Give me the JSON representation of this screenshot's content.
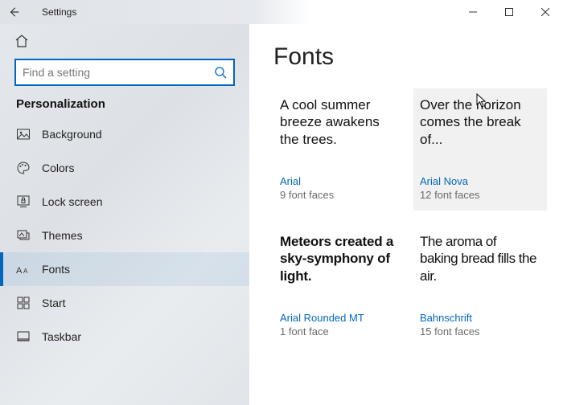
{
  "titlebar": {
    "title": "Settings"
  },
  "search": {
    "placeholder": "Find a setting"
  },
  "sidebar": {
    "section": "Personalization",
    "items": [
      {
        "label": "Background"
      },
      {
        "label": "Colors"
      },
      {
        "label": "Lock screen"
      },
      {
        "label": "Themes"
      },
      {
        "label": "Fonts"
      },
      {
        "label": "Start"
      },
      {
        "label": "Taskbar"
      }
    ],
    "selected_index": 4
  },
  "page": {
    "title": "Fonts"
  },
  "fonts": [
    {
      "sample": "A cool summer breeze awakens the trees.",
      "name": "Arial",
      "faces": "9 font faces",
      "style": "normal"
    },
    {
      "sample": "Over the horizon comes the break of...",
      "name": "Arial Nova",
      "faces": "12 font faces",
      "style": "normal",
      "hover": true
    },
    {
      "sample": "Meteors created a sky-symphony of light.",
      "name": "Arial Rounded MT",
      "faces": "1 font face",
      "style": "rounded"
    },
    {
      "sample": "The aroma of baking bread fills the air.",
      "name": "Bahnschrift",
      "faces": "15 font faces",
      "style": "narrow"
    }
  ]
}
